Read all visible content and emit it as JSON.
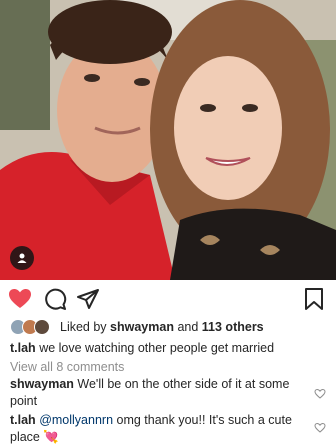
{
  "post": {
    "photo_alt": "",
    "likes": {
      "prefix": "Liked by",
      "user": "shwayman",
      "connector": "and",
      "others": "113 others"
    },
    "caption": {
      "user": "t.lah",
      "text": "we love watching other people get married"
    },
    "view_all": "View all 8 comments",
    "comments": [
      {
        "user": "shwayman",
        "text": "We'll be on the other side of it at some point"
      },
      {
        "user": "t.lah",
        "mention": "@mollyannrn",
        "text": "omg thank you!! It's such a cute place",
        "emoji": "💘"
      }
    ]
  },
  "icons": [
    "user-tag-icon",
    "heart-icon",
    "comment-icon",
    "share-icon",
    "bookmark-icon"
  ],
  "colors": {
    "like_red": "#ed4956",
    "link_blue": "#00376b",
    "muted": "#8e8e8e"
  }
}
